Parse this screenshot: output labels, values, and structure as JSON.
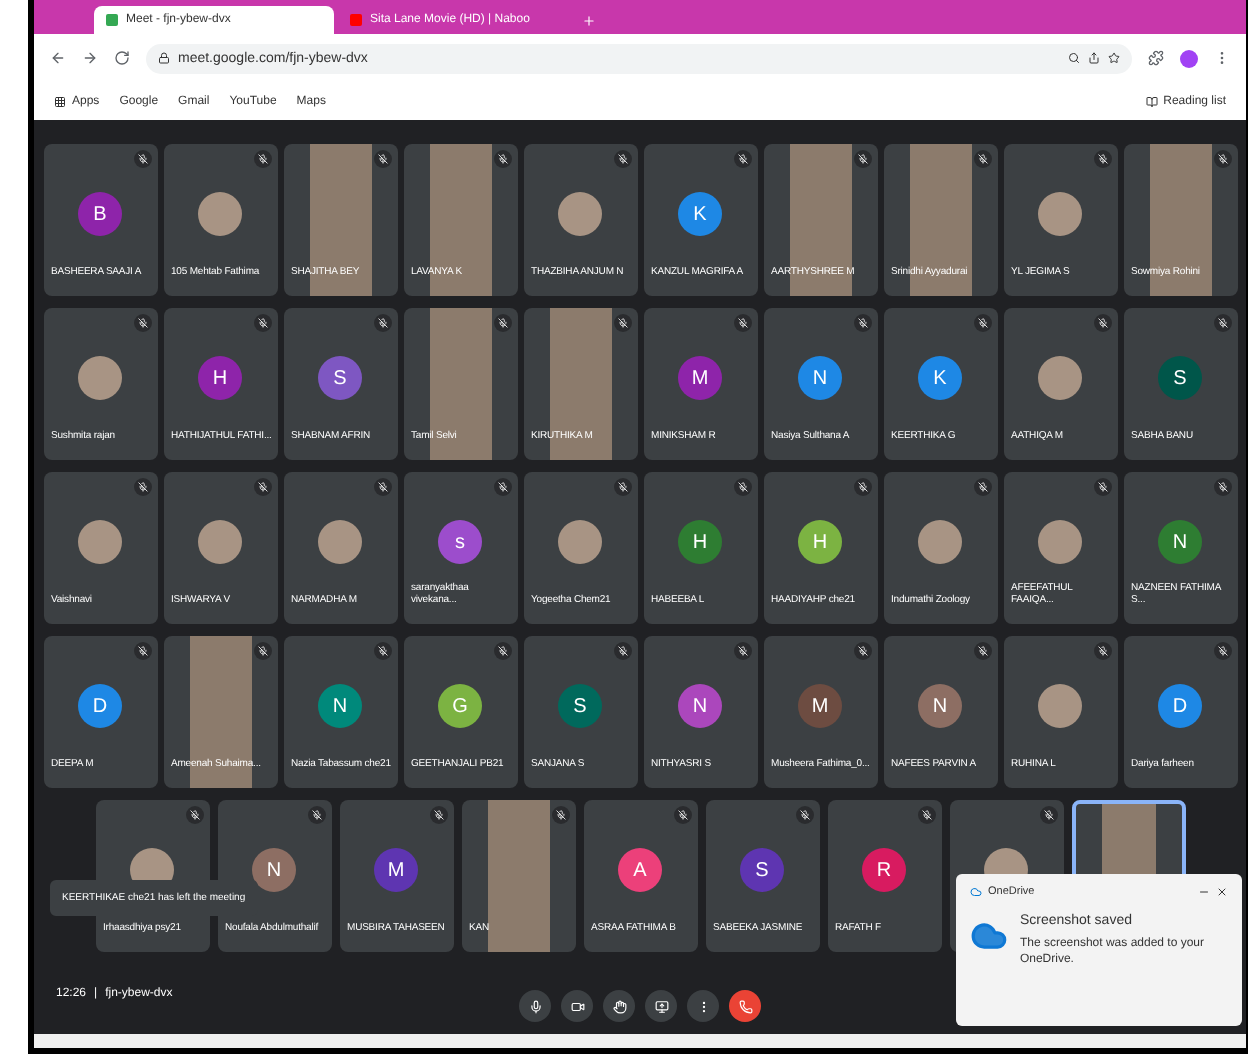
{
  "browser": {
    "tabs": [
      {
        "title": "Meet - fjn-ybew-dvx",
        "selected": true
      },
      {
        "title": "Sita Lane Movie (HD) | Naboo",
        "selected": false
      }
    ],
    "url": "meet.google.com/fjn-ybew-dvx",
    "bookmarks": [
      "Apps",
      "Google",
      "Gmail",
      "YouTube",
      "Maps"
    ],
    "reading_list": "Reading list"
  },
  "meeting": {
    "rows": [
      [
        {
          "kind": "letter",
          "name": "BASHEERA SAAJI A",
          "letter": "B",
          "color": "#8e24aa"
        },
        {
          "kind": "photo",
          "name": "105 Mehtab Fathima"
        },
        {
          "kind": "video",
          "name": "SHAJITHA BEY"
        },
        {
          "kind": "video",
          "name": "LAVANYA K"
        },
        {
          "kind": "photo",
          "name": "THAZBIHA ANJUM N"
        },
        {
          "kind": "letter",
          "name": "KANZUL MAGRIFA A",
          "letter": "K",
          "color": "#1e88e5"
        },
        {
          "kind": "video",
          "name": "AARTHYSHREE M"
        },
        {
          "kind": "video",
          "name": "Srinidhi Ayyadurai"
        },
        {
          "kind": "photo",
          "name": "YL JEGIMA S"
        },
        {
          "kind": "video",
          "name": "Sowmiya Rohini"
        }
      ],
      [
        {
          "kind": "photo",
          "name": "Sushmita rajan"
        },
        {
          "kind": "letter",
          "name": "HATHIJATHUL FATHI...",
          "letter": "H",
          "color": "#8e24aa"
        },
        {
          "kind": "letter",
          "name": "SHABNAM AFRIN",
          "letter": "S",
          "color": "#7e57c2"
        },
        {
          "kind": "video",
          "name": "Tamil Selvi"
        },
        {
          "kind": "video",
          "name": "KIRUTHIKA M"
        },
        {
          "kind": "letter",
          "name": "MINIKSHAM R",
          "letter": "M",
          "color": "#8e24aa"
        },
        {
          "kind": "letter",
          "name": "Nasiya Sulthana A",
          "letter": "N",
          "color": "#1e88e5"
        },
        {
          "kind": "letter",
          "name": "KEERTHIKA G",
          "letter": "K",
          "color": "#1e88e5"
        },
        {
          "kind": "photo",
          "name": "AATHIQA M"
        },
        {
          "kind": "letter",
          "name": "SABHA BANU",
          "letter": "S",
          "color": "#00564a"
        }
      ],
      [
        {
          "kind": "photo",
          "name": "Vaishnavi"
        },
        {
          "kind": "photo",
          "name": "ISHWARYA V"
        },
        {
          "kind": "photo",
          "name": "NARMADHA M"
        },
        {
          "kind": "letter",
          "name": "saranyakthaa vivekana...",
          "letter": "s",
          "color": "#9c4dcc"
        },
        {
          "kind": "photo",
          "name": "Yogeetha Chem21"
        },
        {
          "kind": "letter",
          "name": "HABEEBA L",
          "letter": "H",
          "color": "#2e7d32"
        },
        {
          "kind": "letter",
          "name": "HAADIYAHP che21",
          "letter": "H",
          "color": "#7cb342"
        },
        {
          "kind": "photo",
          "name": "Indumathi Zoology"
        },
        {
          "kind": "photo",
          "name": "AFEEFATHUL FAAIQA..."
        },
        {
          "kind": "letter",
          "name": "NAZNEEN FATHIMA S...",
          "letter": "N",
          "color": "#2e7d32"
        }
      ],
      [
        {
          "kind": "letter",
          "name": "DEEPA M",
          "letter": "D",
          "color": "#1e88e5"
        },
        {
          "kind": "video",
          "name": "Ameenah Suhaima..."
        },
        {
          "kind": "letter",
          "name": "Nazia Tabassum che21",
          "letter": "N",
          "color": "#00897b"
        },
        {
          "kind": "letter",
          "name": "GEETHANJALI PB21",
          "letter": "G",
          "color": "#7cb342"
        },
        {
          "kind": "letter",
          "name": "SANJANA S",
          "letter": "S",
          "color": "#00695c"
        },
        {
          "kind": "letter",
          "name": "NITHYASRI S",
          "letter": "N",
          "color": "#ab47bc"
        },
        {
          "kind": "letter",
          "name": "Musheera Fathima_0...",
          "letter": "M",
          "color": "#6d4c41"
        },
        {
          "kind": "letter",
          "name": "NAFEES PARVIN A",
          "letter": "N",
          "color": "#8d6e63"
        },
        {
          "kind": "photo",
          "name": "RUHINA L"
        },
        {
          "kind": "letter",
          "name": "Dariya farheen",
          "letter": "D",
          "color": "#1e88e5"
        }
      ],
      [
        {
          "kind": "photo",
          "name": "Irhaasdhiya psy21"
        },
        {
          "kind": "letter",
          "name": "Noufala Abdulmuthalif",
          "letter": "N",
          "color": "#8d6e63"
        },
        {
          "kind": "letter",
          "name": "MUSBIRA TAHASEEN",
          "letter": "M",
          "color": "#5e35b1"
        },
        {
          "kind": "video",
          "name": "KAN"
        },
        {
          "kind": "letter",
          "name": "ASRAA FATHIMA B",
          "letter": "A",
          "color": "#ec407a"
        },
        {
          "kind": "letter",
          "name": "SABEEKA JASMINE",
          "letter": "S",
          "color": "#5e35b1"
        },
        {
          "kind": "letter",
          "name": "RAFATH F",
          "letter": "R",
          "color": "#d81b60"
        },
        {
          "kind": "photo"
        },
        {
          "kind": "self"
        }
      ]
    ],
    "time": "12:26",
    "separator": "|",
    "code": "fjn-ybew-dvx",
    "notice": "KEERTHIKAE che21 has left the meeting",
    "toast": {
      "app": "OneDrive",
      "title": "Screenshot saved",
      "message": "The screenshot was added to your OneDrive."
    }
  }
}
